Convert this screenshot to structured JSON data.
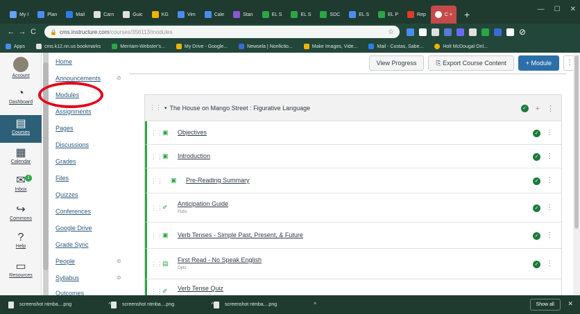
{
  "browser": {
    "tabs": [
      {
        "label": "My I",
        "color": "#6aa0ff"
      },
      {
        "label": "Plan",
        "color": "#4a8df0"
      },
      {
        "label": "Mail",
        "color": "#2b7de9"
      },
      {
        "label": "Carn",
        "color": "#e0e0e0"
      },
      {
        "label": "Guic",
        "color": "#e0e0e0"
      },
      {
        "label": "KG",
        "color": "#f0b400"
      },
      {
        "label": "Vim",
        "color": "#4a8df0"
      },
      {
        "label": "Cale",
        "color": "#4a8df0"
      },
      {
        "label": "Stan",
        "color": "#8a56d6"
      },
      {
        "label": "EL S",
        "color": "#2aa744"
      },
      {
        "label": "EL S",
        "color": "#2aa744"
      },
      {
        "label": "SDC",
        "color": "#2aa744"
      },
      {
        "label": "EL S",
        "color": "#4a8df0"
      },
      {
        "label": "EL P",
        "color": "#2aa744"
      },
      {
        "label": "Rep",
        "color": "#e03a2a"
      }
    ],
    "active_tab": {
      "label": "C",
      "close": "×"
    },
    "new_tab": "+",
    "win_controls": {
      "minimize": "—",
      "maximize": "☐",
      "close": "✕"
    },
    "nav": {
      "back": "←",
      "forward": "→",
      "reload": "C"
    },
    "url_host": "cms.instructure.com",
    "url_path": "/courses/356113/modules",
    "star": "☆",
    "extensions": [
      "#4a8df0",
      "#ffffff",
      "#e0e0e0",
      "#5a7ad6",
      "#6a6aff",
      "#e0e0e0",
      "#2aa744",
      "#3a6ad6",
      "#ffffff"
    ],
    "profile": "⊘"
  },
  "bookmarks": [
    {
      "label": "Apps",
      "color": "#4a8df0"
    },
    {
      "label": "cms.k12.nn.us bookmarks",
      "color": "#e0e0e0"
    },
    {
      "label": "Merriam-Webster's...",
      "color": "#2aa744"
    },
    {
      "label": "My Drive - Google...",
      "color": "#f0b400"
    },
    {
      "label": "Newsela | Nonfictio...",
      "color": "#3a6ad6"
    },
    {
      "label": "Make Images, Vide...",
      "color": "#f0b400"
    },
    {
      "label": "Mail - Costas, Sabe...",
      "color": "#2b7de9"
    },
    {
      "label": "Holt McDougal Onl...",
      "color": "#f0b400"
    }
  ],
  "global_nav": [
    {
      "label": "Account",
      "icon": "●"
    },
    {
      "label": "Dashboard",
      "icon": "◔"
    },
    {
      "label": "Courses",
      "icon": "▤"
    },
    {
      "label": "Calendar",
      "icon": "▦"
    },
    {
      "label": "Inbox",
      "icon": "✉",
      "badge": "1"
    },
    {
      "label": "Commons",
      "icon": "↪"
    },
    {
      "label": "Help",
      "icon": "?"
    },
    {
      "label": "Resources",
      "icon": "▭"
    }
  ],
  "course_nav": [
    {
      "label": "Home"
    },
    {
      "label": "Announcements",
      "eye": "⊘"
    },
    {
      "label": "Modules"
    },
    {
      "label": "Assignments"
    },
    {
      "label": "Pages"
    },
    {
      "label": "Discussions"
    },
    {
      "label": "Grades"
    },
    {
      "label": "Files"
    },
    {
      "label": "Quizzes"
    },
    {
      "label": "Conferences"
    },
    {
      "label": "Google Drive"
    },
    {
      "label": "Grade Sync"
    },
    {
      "label": "People",
      "eye": "⊘"
    },
    {
      "label": "Syllabus",
      "eye": "⊘"
    },
    {
      "label": "Outcomes"
    }
  ],
  "toolbar": {
    "view_progress": "View Progress",
    "export": "Export Course Content",
    "add_module": "+ Module",
    "more": "⋮"
  },
  "module": {
    "drag": "⋮⋮",
    "caret": "▾",
    "title": "The House on Mango Street : Figurative Language",
    "add": "+",
    "more": "⋮",
    "items": [
      {
        "title": "Objectives",
        "icon": "▣",
        "sub": ""
      },
      {
        "title": "Introduction",
        "icon": "▣",
        "sub": ""
      },
      {
        "title": "Pre-Reading Summary",
        "icon": "▣",
        "sub": ""
      },
      {
        "title": "Anticipation Guide",
        "icon": "✐",
        "sub": "Pubs"
      },
      {
        "title": "Verb Tenses - Simple Past, Present, & Future",
        "icon": "▣",
        "sub": ""
      },
      {
        "title": "First Read - No Speak English",
        "icon": "▤",
        "sub": "Opts"
      },
      {
        "title": "Verb Tense Quiz",
        "icon": "✐",
        "sub": ""
      }
    ]
  },
  "downloads": [
    {
      "label": "screenshot ntmba....png"
    },
    {
      "label": "screenshot ntmba....png"
    },
    {
      "label": "screenshot ntmba....png"
    }
  ],
  "download_chev": "^",
  "show_all": "Show all",
  "shelf_close": "✕",
  "colors": {
    "accent": "#2d6fa8",
    "success": "#1e7a3c",
    "annotation": "#e3001b"
  }
}
